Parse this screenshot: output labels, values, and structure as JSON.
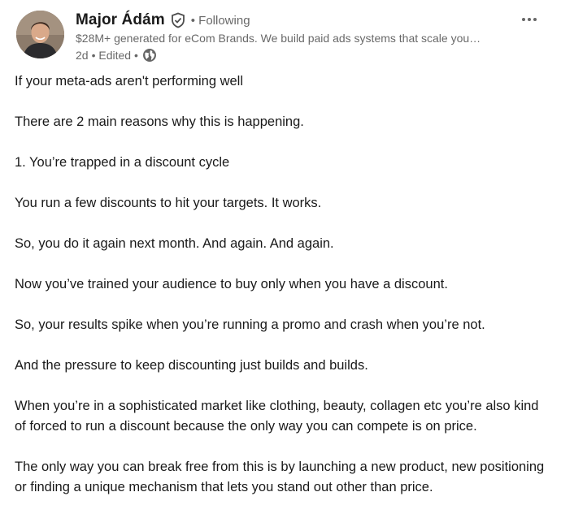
{
  "author": {
    "name": "Major Ádám",
    "follow_status": "• Following",
    "headline": "$28M+ generated for eCom Brands. We build paid ads systems that scale you…",
    "post_age": "2d",
    "edited": "• Edited •"
  },
  "icons": {
    "verified": "verified-shield-icon",
    "visibility": "globe-icon",
    "more": "more-dots-icon"
  },
  "colors": {
    "text_primary": "#191919",
    "text_secondary": "#666666"
  },
  "post": {
    "paragraphs": [
      "If your meta-ads aren't performing well",
      "There are 2 main reasons why this is happening.",
      "1. You’re trapped in a discount cycle",
      "You run a few discounts to hit your targets. It works.",
      "So, you do it again next month. And again. And again.",
      "Now you’ve trained your audience to buy only when you have a discount.",
      "So, your results spike when you’re running a promo and crash when you’re not.",
      "And the pressure to keep discounting just builds and builds.",
      "When you’re in a sophisticated market like clothing, beauty, collagen etc you’re also kind of forced to run a discount because the only way you can compete is on price.",
      "The only way you can break free from this is by launching a new product, new positioning or finding a unique mechanism that lets you stand out other than price."
    ]
  }
}
